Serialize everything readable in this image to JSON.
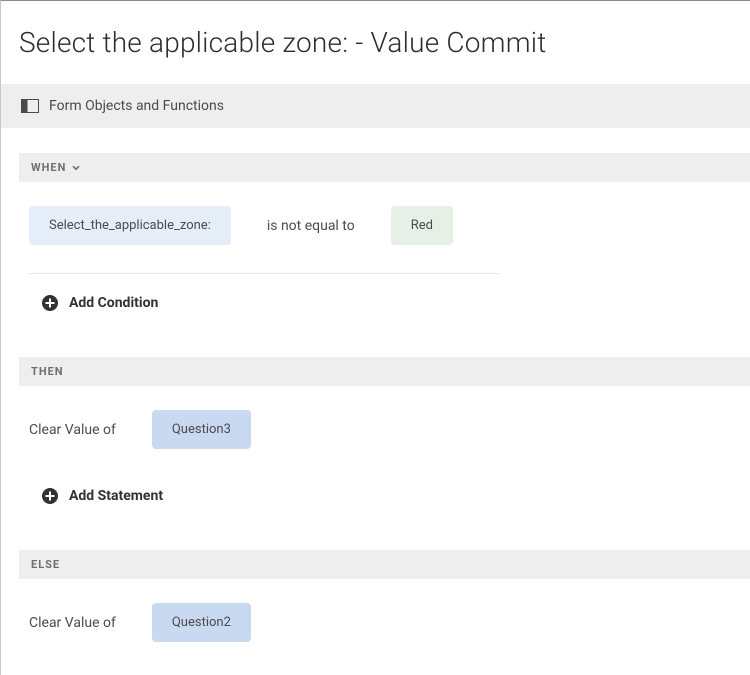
{
  "page": {
    "title": "Select the applicable zone: - Value Commit"
  },
  "toolbar": {
    "label": "Form Objects and Functions"
  },
  "sections": {
    "when": {
      "header": "WHEN",
      "condition": {
        "field": "Select_the_applicable_zone:",
        "operator": "is not equal to",
        "value": "Red"
      },
      "add_condition": "Add Condition"
    },
    "then": {
      "header": "THEN",
      "action": {
        "text": "Clear Value of",
        "target": "Question3"
      },
      "add_statement": "Add Statement"
    },
    "else": {
      "header": "ELSE",
      "action": {
        "text": "Clear Value of",
        "target": "Question2"
      }
    }
  }
}
